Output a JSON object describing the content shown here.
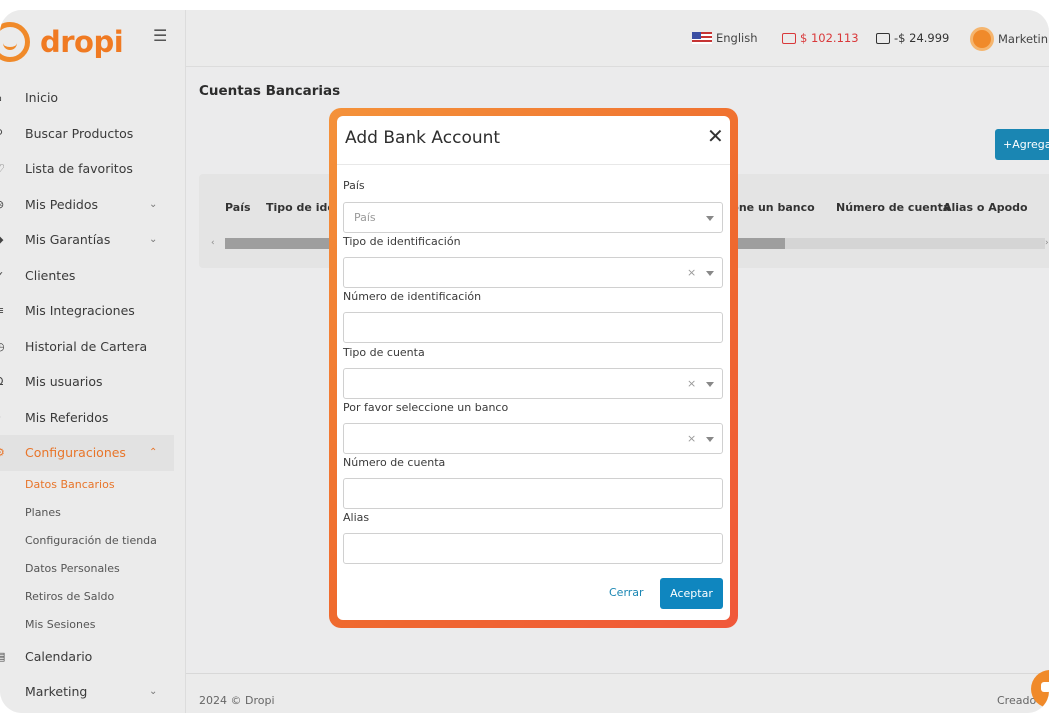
{
  "brand": {
    "logo_text": "dropi",
    "accent": "#f07a22",
    "primary_blue": "#0f86bf"
  },
  "topbar": {
    "language": "English",
    "balance_positive": "$ 102.113",
    "balance_negative": "-$ 24.999",
    "user": "Marketin"
  },
  "sidebar": {
    "items": [
      {
        "label": "Inicio",
        "icon": "home-icon"
      },
      {
        "label": "Buscar Productos",
        "icon": "search-icon"
      },
      {
        "label": "Lista de favoritos",
        "icon": "heart-icon"
      },
      {
        "label": "Mis Pedidos",
        "icon": "cart-icon"
      },
      {
        "label": "Mis Garantías",
        "icon": "shield-icon"
      },
      {
        "label": "Clientes",
        "icon": "user-icon"
      },
      {
        "label": "Mis Integraciones",
        "icon": "plug-icon"
      },
      {
        "label": "Historial de Cartera",
        "icon": "history-icon"
      },
      {
        "label": "Mis usuarios",
        "icon": "users-icon"
      },
      {
        "label": "Mis Referidos",
        "icon": "referral-icon"
      },
      {
        "label": "Configuraciones",
        "icon": "gear-icon"
      }
    ],
    "subitems": [
      "Datos Bancarios",
      "Planes",
      "Configuración de tienda",
      "Datos Personales",
      "Retiros de Saldo",
      "Mis Sesiones"
    ],
    "after": [
      {
        "label": "Calendario",
        "icon": "calendar-icon"
      },
      {
        "label": "Marketing",
        "icon": "megaphone-icon"
      }
    ]
  },
  "page": {
    "title": "Cuentas Bancarias",
    "add_button": "+Agrega",
    "table_headers": [
      "País",
      "Tipo de ider",
      "cione un banco",
      "Número de cuenta",
      "Alias o Apodo"
    ]
  },
  "footer": {
    "left": "2024 © Dropi",
    "right": "Creado"
  },
  "modal": {
    "title": "Add Bank Account",
    "fields": [
      {
        "label": "País",
        "placeholder": "País"
      },
      {
        "label": "Tipo de identificación",
        "placeholder": ""
      },
      {
        "label": "Número de identificación",
        "placeholder": ""
      },
      {
        "label": "Tipo de cuenta",
        "placeholder": ""
      },
      {
        "label": "Por favor seleccione un banco",
        "placeholder": ""
      },
      {
        "label": "Número de cuenta",
        "placeholder": ""
      },
      {
        "label": "Alias",
        "placeholder": ""
      }
    ],
    "cancel_label": "Cerrar",
    "accept_label": "Aceptar"
  }
}
